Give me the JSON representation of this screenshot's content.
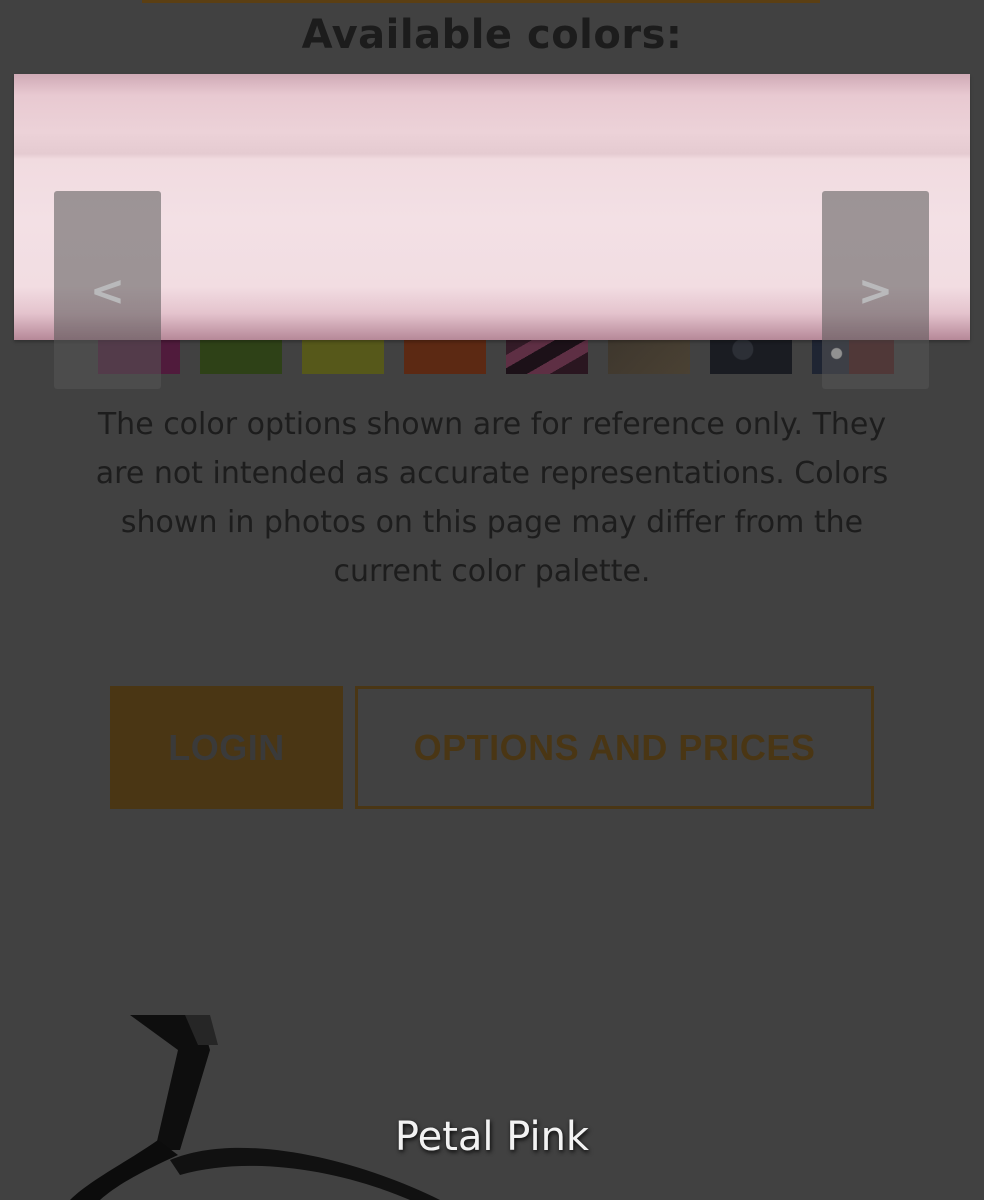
{
  "colors_section": {
    "title": "Available colors:",
    "selected_color": "Petal Pink",
    "selected_color_hex": "#f2dde2",
    "prev_label": "<",
    "next_label": ">",
    "swatches": [
      {
        "name": "magenta",
        "hex": "#501b3c"
      },
      {
        "name": "green",
        "hex": "#2e4117"
      },
      {
        "name": "yellow-green",
        "hex": "#56581a"
      },
      {
        "name": "orange",
        "hex": "#5c2913"
      },
      {
        "name": "pink-camo",
        "hex": "#4a2535"
      },
      {
        "name": "tan",
        "hex": "#443b30"
      },
      {
        "name": "black-speckle",
        "hex": "#22252c"
      },
      {
        "name": "stars-and-stripes",
        "hex": "#3a1e22"
      }
    ],
    "disclaimer": "The color options shown are for reference only. They are not intended as accurate representations. Colors shown in photos on this page may differ from the current color palette."
  },
  "actions": {
    "login_label": "LOGIN",
    "options_label": "OPTIONS AND PRICES",
    "accent_color": "#4a3614"
  },
  "product": {
    "caption": "Petal Pink"
  }
}
